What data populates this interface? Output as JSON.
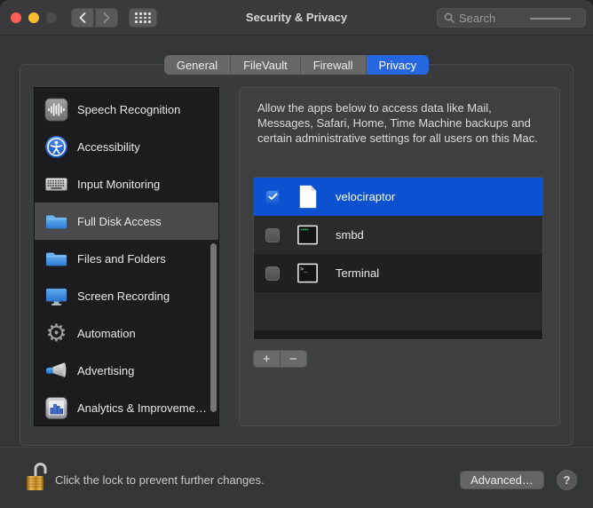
{
  "window": {
    "title": "Security & Privacy"
  },
  "toolbar": {
    "search_placeholder": "Search"
  },
  "tabs": [
    {
      "label": "General",
      "selected": false
    },
    {
      "label": "FileVault",
      "selected": false
    },
    {
      "label": "Firewall",
      "selected": false
    },
    {
      "label": "Privacy",
      "selected": true
    }
  ],
  "sidebar": {
    "items": [
      {
        "label": "Speech Recognition",
        "icon": "speech-waveform"
      },
      {
        "label": "Accessibility",
        "icon": "accessibility-figure"
      },
      {
        "label": "Input Monitoring",
        "icon": "keyboard"
      },
      {
        "label": "Full Disk Access",
        "icon": "blue-folder",
        "selected": true
      },
      {
        "label": "Files and Folders",
        "icon": "blue-folder"
      },
      {
        "label": "Screen Recording",
        "icon": "display"
      },
      {
        "label": "Automation",
        "icon": "gear"
      },
      {
        "label": "Advertising",
        "icon": "megaphone"
      },
      {
        "label": "Analytics & Improveme…",
        "icon": "bar-chart"
      }
    ]
  },
  "panel": {
    "description": "Allow the apps below to access data like Mail, Messages, Safari, Home, Time Machine backups and certain administrative settings for all users on this Mac.",
    "apps": [
      {
        "name": "velociraptor",
        "checked": true,
        "selected": true,
        "icon": "document"
      },
      {
        "name": "smbd",
        "checked": false,
        "selected": false,
        "icon": "unix-executable"
      },
      {
        "name": "Terminal",
        "checked": false,
        "selected": false,
        "icon": "terminal"
      }
    ],
    "add_label": "+",
    "remove_label": "−"
  },
  "footer": {
    "lock_state": "unlocked",
    "lock_text": "Click the lock to prevent further changes.",
    "advanced_label": "Advanced…",
    "help_label": "?"
  },
  "colors": {
    "accent_row_blue": "#0b51d0",
    "tab_selected_blue": "#2667df",
    "close_red": "#ff5f57",
    "minimize_yellow": "#febc2e",
    "zoom_disabled_gray": "#4c4c4e"
  }
}
